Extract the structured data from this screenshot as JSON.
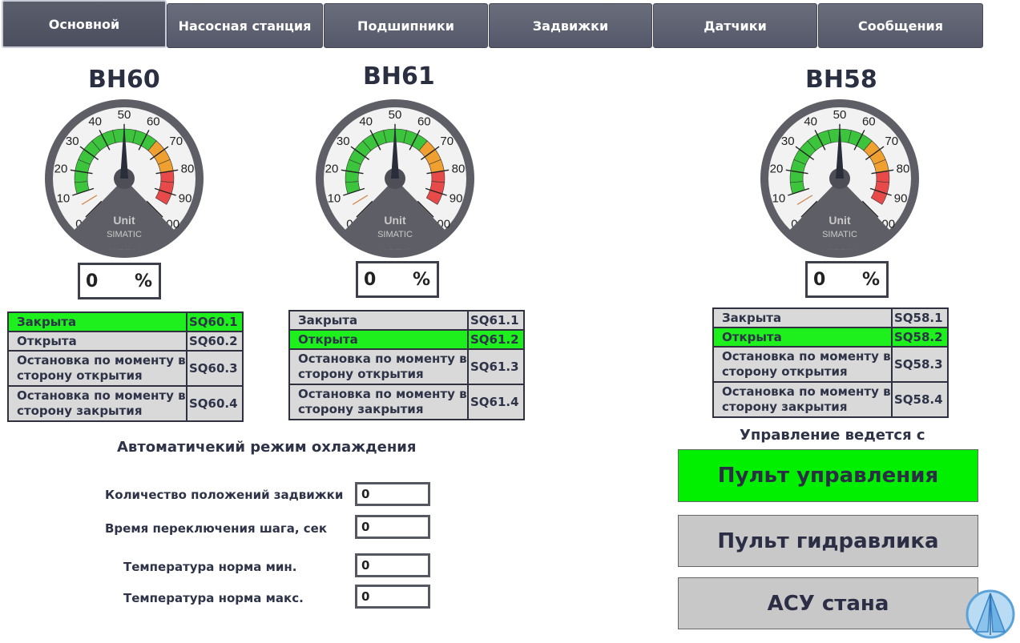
{
  "tabs": [
    {
      "label": "Основной"
    },
    {
      "label": "Насосная станция"
    },
    {
      "label": "Подшипники"
    },
    {
      "label": "Задвижки"
    },
    {
      "label": "Датчики"
    },
    {
      "label": "Сообщения"
    }
  ],
  "gauge": {
    "ticks": [
      "0",
      "10",
      "20",
      "30",
      "40",
      "50",
      "60",
      "70",
      "80",
      "90",
      "100"
    ],
    "unit_label": "Unit",
    "brand_label": "SIMATIC",
    "colors": {
      "green": "#3cc43c",
      "orange": "#f0a030",
      "red": "#e84a4a",
      "face": "#f2f2f2",
      "rim": "#5e5f66"
    }
  },
  "valves": [
    {
      "title": "ВН60",
      "value": "0",
      "unit": "%",
      "rows": [
        {
          "label": "Закрыта",
          "code": "SQ60.1",
          "active": true
        },
        {
          "label": "Открыта",
          "code": "SQ60.2",
          "active": false
        },
        {
          "label": "Остановка по моменту в сторону открытия",
          "code": "SQ60.3",
          "active": false
        },
        {
          "label": "Остановка по моменту в сторону закрытия",
          "code": "SQ60.4",
          "active": false
        }
      ]
    },
    {
      "title": "ВН61",
      "value": "0",
      "unit": "%",
      "rows": [
        {
          "label": "Закрыта",
          "code": "SQ61.1",
          "active": false
        },
        {
          "label": "Открыта",
          "code": "SQ61.2",
          "active": true
        },
        {
          "label": "Остановка по моменту в сторону открытия",
          "code": "SQ61.3",
          "active": false
        },
        {
          "label": "Остановка по моменту в сторону закрытия",
          "code": "SQ61.4",
          "active": false
        }
      ]
    },
    {
      "title": "ВН58",
      "value": "0",
      "unit": "%",
      "rows": [
        {
          "label": "Закрыта",
          "code": "SQ58.1",
          "active": false
        },
        {
          "label": "Открыта",
          "code": "SQ58.2",
          "active": true
        },
        {
          "label": "Остановка по моменту в сторону открытия",
          "code": "SQ58.3",
          "active": false
        },
        {
          "label": "Остановка по моменту в сторону закрытия",
          "code": "SQ58.4",
          "active": false
        }
      ]
    }
  ],
  "auto_cooling": {
    "title": "Автоматичекий режим охлаждения",
    "fields": [
      {
        "label": "Количество положений задвижки",
        "value": "0"
      },
      {
        "label": "Время переключения шага, сек",
        "value": "0"
      },
      {
        "label": "Температура норма мин.",
        "value": "0"
      },
      {
        "label": "Температура норма макс.",
        "value": "0"
      }
    ]
  },
  "control": {
    "title": "Управление ведется с",
    "buttons": [
      {
        "label": "Пульт управления",
        "active": true
      },
      {
        "label": "Пульт гидравлика",
        "active": false
      },
      {
        "label": "АСУ стана",
        "active": false
      }
    ],
    "active_color": "#00f000",
    "inactive_color": "#c8c8c8"
  },
  "logo_icon": "company-logo-icon"
}
